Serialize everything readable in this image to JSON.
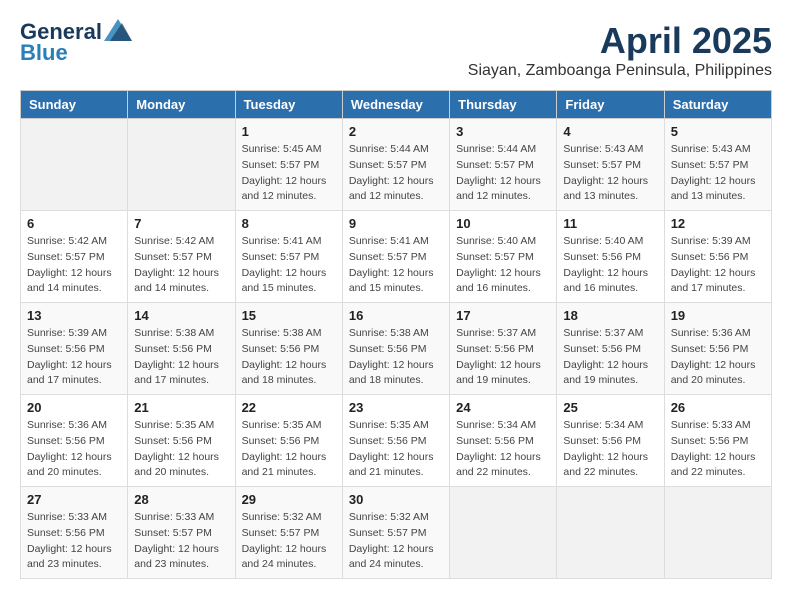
{
  "header": {
    "logo_line1": "General",
    "logo_line2": "Blue",
    "month": "April 2025",
    "location": "Siayan, Zamboanga Peninsula, Philippines"
  },
  "weekdays": [
    "Sunday",
    "Monday",
    "Tuesday",
    "Wednesday",
    "Thursday",
    "Friday",
    "Saturday"
  ],
  "weeks": [
    [
      {
        "day": "",
        "sunrise": "",
        "sunset": "",
        "daylight": ""
      },
      {
        "day": "",
        "sunrise": "",
        "sunset": "",
        "daylight": ""
      },
      {
        "day": "1",
        "sunrise": "Sunrise: 5:45 AM",
        "sunset": "Sunset: 5:57 PM",
        "daylight": "Daylight: 12 hours and 12 minutes."
      },
      {
        "day": "2",
        "sunrise": "Sunrise: 5:44 AM",
        "sunset": "Sunset: 5:57 PM",
        "daylight": "Daylight: 12 hours and 12 minutes."
      },
      {
        "day": "3",
        "sunrise": "Sunrise: 5:44 AM",
        "sunset": "Sunset: 5:57 PM",
        "daylight": "Daylight: 12 hours and 12 minutes."
      },
      {
        "day": "4",
        "sunrise": "Sunrise: 5:43 AM",
        "sunset": "Sunset: 5:57 PM",
        "daylight": "Daylight: 12 hours and 13 minutes."
      },
      {
        "day": "5",
        "sunrise": "Sunrise: 5:43 AM",
        "sunset": "Sunset: 5:57 PM",
        "daylight": "Daylight: 12 hours and 13 minutes."
      }
    ],
    [
      {
        "day": "6",
        "sunrise": "Sunrise: 5:42 AM",
        "sunset": "Sunset: 5:57 PM",
        "daylight": "Daylight: 12 hours and 14 minutes."
      },
      {
        "day": "7",
        "sunrise": "Sunrise: 5:42 AM",
        "sunset": "Sunset: 5:57 PM",
        "daylight": "Daylight: 12 hours and 14 minutes."
      },
      {
        "day": "8",
        "sunrise": "Sunrise: 5:41 AM",
        "sunset": "Sunset: 5:57 PM",
        "daylight": "Daylight: 12 hours and 15 minutes."
      },
      {
        "day": "9",
        "sunrise": "Sunrise: 5:41 AM",
        "sunset": "Sunset: 5:57 PM",
        "daylight": "Daylight: 12 hours and 15 minutes."
      },
      {
        "day": "10",
        "sunrise": "Sunrise: 5:40 AM",
        "sunset": "Sunset: 5:57 PM",
        "daylight": "Daylight: 12 hours and 16 minutes."
      },
      {
        "day": "11",
        "sunrise": "Sunrise: 5:40 AM",
        "sunset": "Sunset: 5:56 PM",
        "daylight": "Daylight: 12 hours and 16 minutes."
      },
      {
        "day": "12",
        "sunrise": "Sunrise: 5:39 AM",
        "sunset": "Sunset: 5:56 PM",
        "daylight": "Daylight: 12 hours and 17 minutes."
      }
    ],
    [
      {
        "day": "13",
        "sunrise": "Sunrise: 5:39 AM",
        "sunset": "Sunset: 5:56 PM",
        "daylight": "Daylight: 12 hours and 17 minutes."
      },
      {
        "day": "14",
        "sunrise": "Sunrise: 5:38 AM",
        "sunset": "Sunset: 5:56 PM",
        "daylight": "Daylight: 12 hours and 17 minutes."
      },
      {
        "day": "15",
        "sunrise": "Sunrise: 5:38 AM",
        "sunset": "Sunset: 5:56 PM",
        "daylight": "Daylight: 12 hours and 18 minutes."
      },
      {
        "day": "16",
        "sunrise": "Sunrise: 5:38 AM",
        "sunset": "Sunset: 5:56 PM",
        "daylight": "Daylight: 12 hours and 18 minutes."
      },
      {
        "day": "17",
        "sunrise": "Sunrise: 5:37 AM",
        "sunset": "Sunset: 5:56 PM",
        "daylight": "Daylight: 12 hours and 19 minutes."
      },
      {
        "day": "18",
        "sunrise": "Sunrise: 5:37 AM",
        "sunset": "Sunset: 5:56 PM",
        "daylight": "Daylight: 12 hours and 19 minutes."
      },
      {
        "day": "19",
        "sunrise": "Sunrise: 5:36 AM",
        "sunset": "Sunset: 5:56 PM",
        "daylight": "Daylight: 12 hours and 20 minutes."
      }
    ],
    [
      {
        "day": "20",
        "sunrise": "Sunrise: 5:36 AM",
        "sunset": "Sunset: 5:56 PM",
        "daylight": "Daylight: 12 hours and 20 minutes."
      },
      {
        "day": "21",
        "sunrise": "Sunrise: 5:35 AM",
        "sunset": "Sunset: 5:56 PM",
        "daylight": "Daylight: 12 hours and 20 minutes."
      },
      {
        "day": "22",
        "sunrise": "Sunrise: 5:35 AM",
        "sunset": "Sunset: 5:56 PM",
        "daylight": "Daylight: 12 hours and 21 minutes."
      },
      {
        "day": "23",
        "sunrise": "Sunrise: 5:35 AM",
        "sunset": "Sunset: 5:56 PM",
        "daylight": "Daylight: 12 hours and 21 minutes."
      },
      {
        "day": "24",
        "sunrise": "Sunrise: 5:34 AM",
        "sunset": "Sunset: 5:56 PM",
        "daylight": "Daylight: 12 hours and 22 minutes."
      },
      {
        "day": "25",
        "sunrise": "Sunrise: 5:34 AM",
        "sunset": "Sunset: 5:56 PM",
        "daylight": "Daylight: 12 hours and 22 minutes."
      },
      {
        "day": "26",
        "sunrise": "Sunrise: 5:33 AM",
        "sunset": "Sunset: 5:56 PM",
        "daylight": "Daylight: 12 hours and 22 minutes."
      }
    ],
    [
      {
        "day": "27",
        "sunrise": "Sunrise: 5:33 AM",
        "sunset": "Sunset: 5:56 PM",
        "daylight": "Daylight: 12 hours and 23 minutes."
      },
      {
        "day": "28",
        "sunrise": "Sunrise: 5:33 AM",
        "sunset": "Sunset: 5:57 PM",
        "daylight": "Daylight: 12 hours and 23 minutes."
      },
      {
        "day": "29",
        "sunrise": "Sunrise: 5:32 AM",
        "sunset": "Sunset: 5:57 PM",
        "daylight": "Daylight: 12 hours and 24 minutes."
      },
      {
        "day": "30",
        "sunrise": "Sunrise: 5:32 AM",
        "sunset": "Sunset: 5:57 PM",
        "daylight": "Daylight: 12 hours and 24 minutes."
      },
      {
        "day": "",
        "sunrise": "",
        "sunset": "",
        "daylight": ""
      },
      {
        "day": "",
        "sunrise": "",
        "sunset": "",
        "daylight": ""
      },
      {
        "day": "",
        "sunrise": "",
        "sunset": "",
        "daylight": ""
      }
    ]
  ]
}
